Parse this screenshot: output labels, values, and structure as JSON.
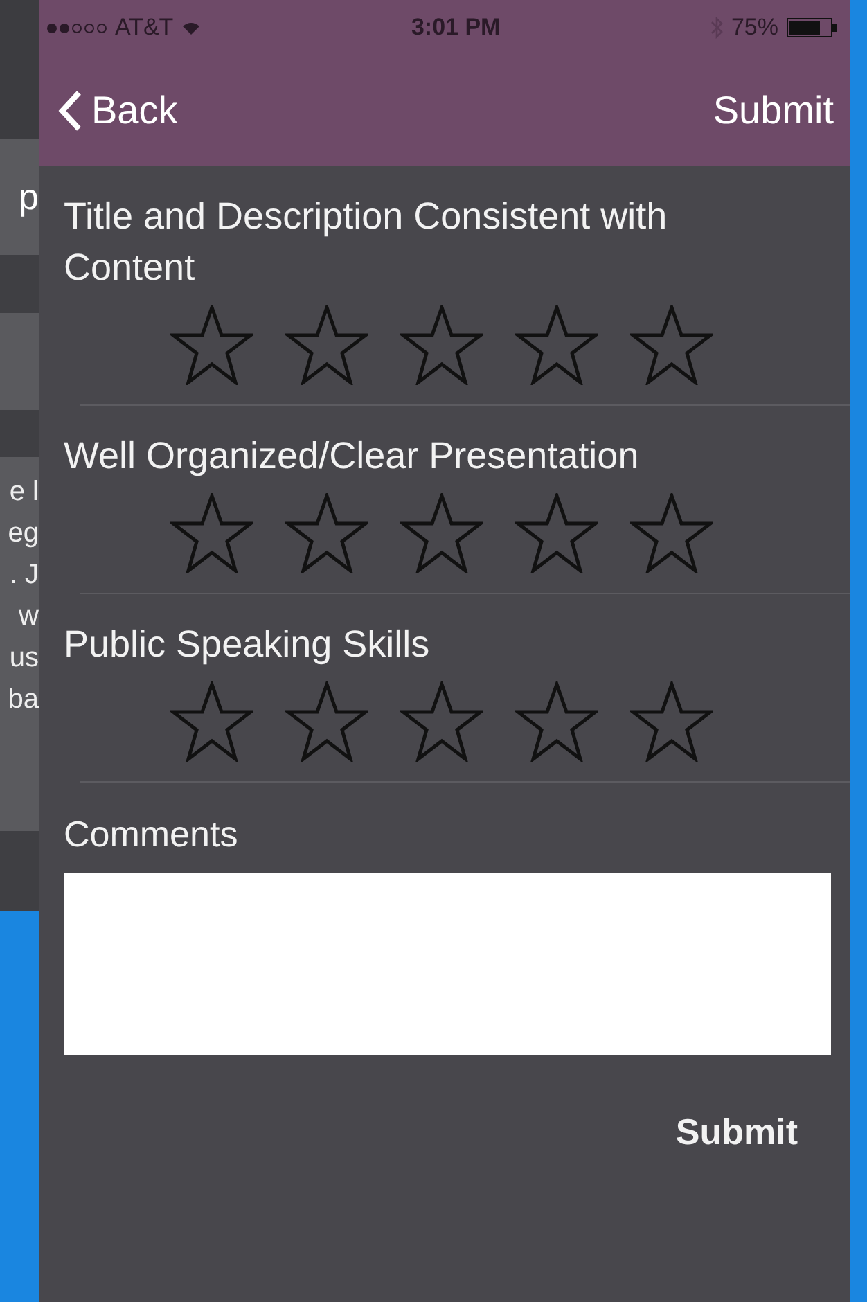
{
  "background_app": {
    "button_text": "p",
    "text_lines": [
      "e l",
      "eg",
      ". J",
      "w",
      "us",
      "ba"
    ]
  },
  "status_bar": {
    "carrier": "AT&T",
    "time": "3:01 PM",
    "battery": "75%"
  },
  "nav": {
    "back": "Back",
    "action": "Submit"
  },
  "ratings": [
    {
      "label": "Title and Description Consistent with Content",
      "stars": 0
    },
    {
      "label": "Well Organized/Clear Presentation",
      "stars": 0
    },
    {
      "label": "Public Speaking Skills",
      "stars": 0
    }
  ],
  "comments": {
    "label": "Comments"
  },
  "submit": "Submit"
}
